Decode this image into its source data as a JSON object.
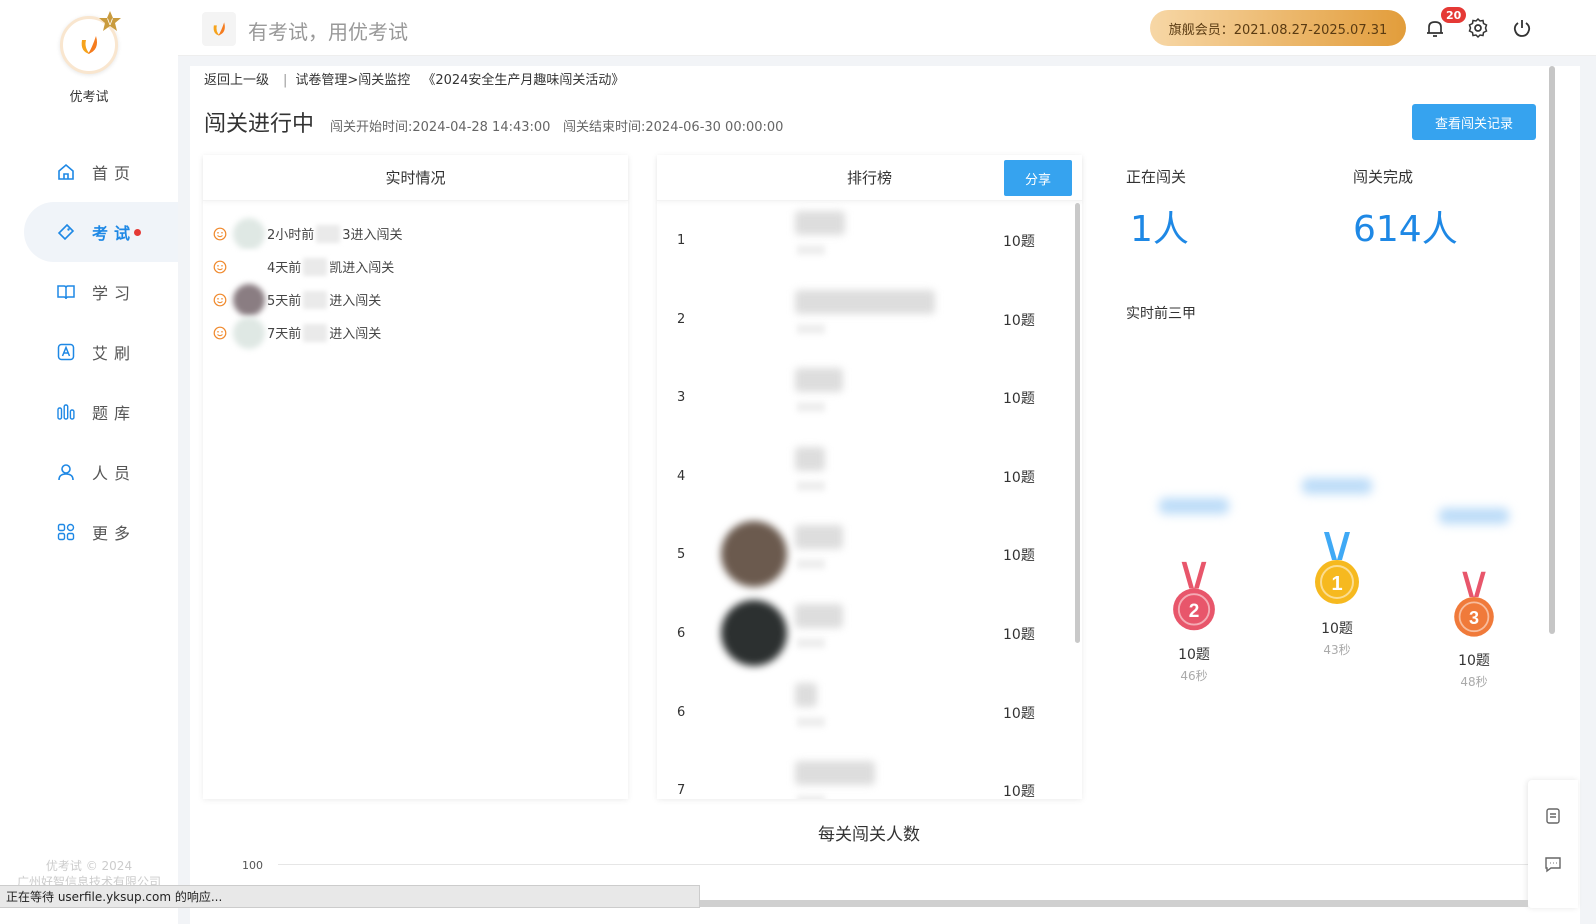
{
  "app": {
    "name": "优考试",
    "slogan": "有考试，用优考试"
  },
  "sidebar": {
    "items": [
      {
        "label": "首页",
        "icon": "home-icon",
        "active": false
      },
      {
        "label": "考试",
        "icon": "exam-tag-icon",
        "active": true
      },
      {
        "label": "学习",
        "icon": "book-icon",
        "active": false
      },
      {
        "label": "艾刷",
        "icon": "a-letter-icon",
        "active": false
      },
      {
        "label": "题库",
        "icon": "bar-chart-icon",
        "active": false
      },
      {
        "label": "人员",
        "icon": "user-icon",
        "active": false
      },
      {
        "label": "更多",
        "icon": "grid-icon",
        "active": false
      }
    ],
    "footer_copyright": "优考试 © 2024",
    "footer_company": "广州好智信息技术有限公司"
  },
  "topbar": {
    "vip_label": "旗舰会员：2021.08.27-2025.07.31",
    "notification_count": "20"
  },
  "breadcrumb": {
    "back": "返回上一级",
    "path": "试卷管理>闯关监控",
    "activity": "《2024安全生产月趣味闯关活动》"
  },
  "status": {
    "title": "闯关进行中",
    "start_time": "闯关开始时间:2024-04-28 14:43:00",
    "end_time": "闯关结束时间:2024-06-30 00:00:00",
    "record_button": "查看闯关记录"
  },
  "realtime": {
    "title": "实时情况",
    "items": [
      {
        "prefix": "2小时前",
        "suffix": "3进入闯关",
        "avatar_color": "#dfe8e4"
      },
      {
        "prefix": "4天前",
        "suffix": "凯进入闯关",
        "avatar_color": "#ffffff"
      },
      {
        "prefix": "5天前",
        "suffix": "进入闯关",
        "avatar_color": "#8a7d82"
      },
      {
        "prefix": "7天前",
        "suffix": "进入闯关",
        "avatar_color": "#dfe8e4"
      }
    ]
  },
  "leaderboard": {
    "title": "排行榜",
    "share_button": "分享",
    "rows": [
      {
        "rank": "1",
        "score": "10题",
        "avatar_color": "#ffffff",
        "name_width": 50
      },
      {
        "rank": "2",
        "score": "10题",
        "avatar_color": "#ffffff",
        "name_width": 140
      },
      {
        "rank": "3",
        "score": "10题",
        "avatar_color": "#ffffff",
        "name_width": 48
      },
      {
        "rank": "4",
        "score": "10题",
        "avatar_color": "#ffffff",
        "name_width": 30
      },
      {
        "rank": "5",
        "score": "10题",
        "avatar_color": "#6b5a4e",
        "name_width": 48
      },
      {
        "rank": "6",
        "score": "10题",
        "avatar_color": "#2c3030",
        "name_width": 48
      },
      {
        "rank": "6",
        "score": "10题",
        "avatar_color": "#ffffff",
        "name_width": 22
      },
      {
        "rank": "7",
        "score": "10题",
        "avatar_color": "#ffffff",
        "name_width": 80
      }
    ]
  },
  "stats": {
    "in_progress_label": "正在闯关",
    "in_progress_value": "1人",
    "completed_label": "闯关完成",
    "completed_value": "614人"
  },
  "top3": {
    "title": "实时前三甲",
    "podium": [
      {
        "place": "2",
        "score": "10题",
        "time": "46秒",
        "medal_color": "#e8566b",
        "ribbon": "#e8566b"
      },
      {
        "place": "1",
        "score": "10题",
        "time": "43秒",
        "medal_color": "#f6b91f",
        "ribbon": "#3fa9f5"
      },
      {
        "place": "3",
        "score": "10题",
        "time": "48秒",
        "medal_color": "#f07a3a",
        "ribbon": "#e8566b"
      }
    ]
  },
  "chart_data": {
    "type": "bar",
    "title": "每关闯关人数",
    "yticks": [
      "100"
    ]
  },
  "browser_status": "正在等待 userfile.yksup.com 的响应...",
  "colors": {
    "accent": "#1e88e5",
    "button": "#36a3ef",
    "badge": "#e53935"
  }
}
